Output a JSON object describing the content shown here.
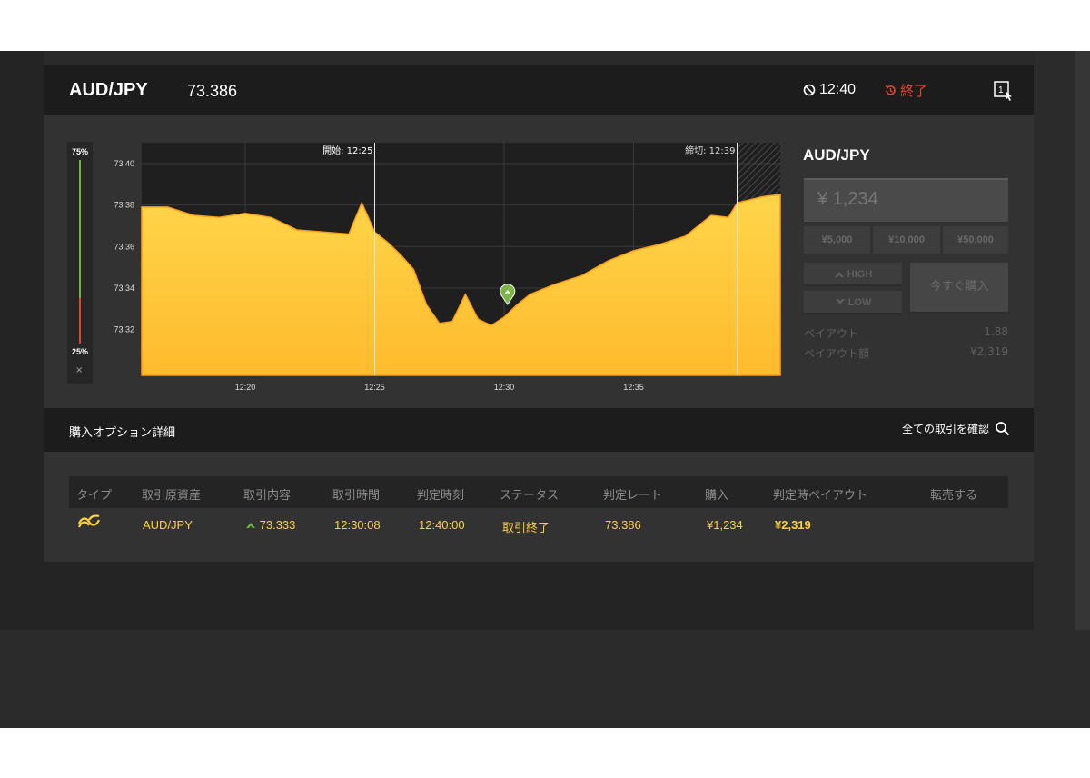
{
  "header": {
    "pair": "AUD/JPY",
    "price": "73.386",
    "time": "12:40",
    "ended": "終了",
    "oneclick_icon": "one-click-icon"
  },
  "gauge": {
    "high_pct": "75%",
    "low_pct": "25%",
    "close": "×",
    "high_fraction": 0.75
  },
  "chart_data": {
    "type": "area",
    "title": "",
    "xlabel": "",
    "ylabel": "",
    "ylim": [
      73.298,
      73.41
    ],
    "xlim": [
      "12:16:00",
      "12:40:40"
    ],
    "yticks": [
      "73.40",
      "73.38",
      "73.36",
      "73.34",
      "73.32"
    ],
    "xticks": [
      "12:20",
      "12:25",
      "12:30",
      "12:35"
    ],
    "start_label": "開始: 12:25",
    "end_label": "締切: 12:39",
    "entry": {
      "time": "12:30:08",
      "value": 73.333,
      "direction": "HIGH"
    },
    "series": [
      {
        "x": [
          "12:16:00",
          "12:17:00",
          "12:18:00",
          "12:19:00",
          "12:20:00",
          "12:21:00",
          "12:22:00",
          "12:23:00",
          "12:24:00",
          "12:24:30",
          "12:25:00",
          "12:25:30",
          "12:26:00",
          "12:26:30",
          "12:27:00",
          "12:27:30",
          "12:28:00",
          "12:28:30",
          "12:29:00",
          "12:29:30",
          "12:30:00",
          "12:30:30",
          "12:31:00",
          "12:32:00",
          "12:33:00",
          "12:34:00",
          "12:35:00",
          "12:36:00",
          "12:37:00",
          "12:38:00",
          "12:38:40",
          "12:39:00",
          "12:40:00",
          "12:40:40"
        ],
        "values": [
          73.379,
          73.379,
          73.375,
          73.374,
          73.376,
          73.374,
          73.368,
          73.367,
          73.366,
          73.381,
          73.367,
          73.362,
          73.356,
          73.349,
          73.332,
          73.323,
          73.324,
          73.337,
          73.325,
          73.322,
          73.326,
          73.332,
          73.337,
          73.342,
          73.346,
          73.353,
          73.358,
          73.361,
          73.365,
          73.375,
          73.374,
          73.381,
          73.384,
          73.385
        ]
      }
    ]
  },
  "buy": {
    "title": "AUD/JPY",
    "amount": "¥ 1,234",
    "presets": [
      "¥5,000",
      "¥10,000",
      "¥50,000"
    ],
    "high": "HIGH",
    "low": "LOW",
    "buy_now": "今すぐ購入",
    "payout_label": "ペイアウト",
    "payout_value": "1.88",
    "payout_amount_label": "ペイアウト額",
    "payout_amount_value": "¥2,319"
  },
  "details": {
    "title": "購入オプション詳細",
    "confirm": "全ての取引を確認",
    "headers": [
      "タイプ",
      "取引原資産",
      "取引内容",
      "取引時間",
      "判定時刻",
      "ステータス",
      "判定レート",
      "購入",
      "判定時ペイアウト",
      "転売する"
    ],
    "row": {
      "asset": "AUD/JPY",
      "content": "73.333",
      "trade_time": "12:30:08",
      "judge_time": "12:40:00",
      "status": "取引終了",
      "rate": "73.386",
      "purchase": "¥1,234",
      "payout": "¥2,319"
    }
  },
  "colors": {
    "accent": "#ffc93c",
    "ended": "#e2462f",
    "high": "#6fb53a"
  }
}
